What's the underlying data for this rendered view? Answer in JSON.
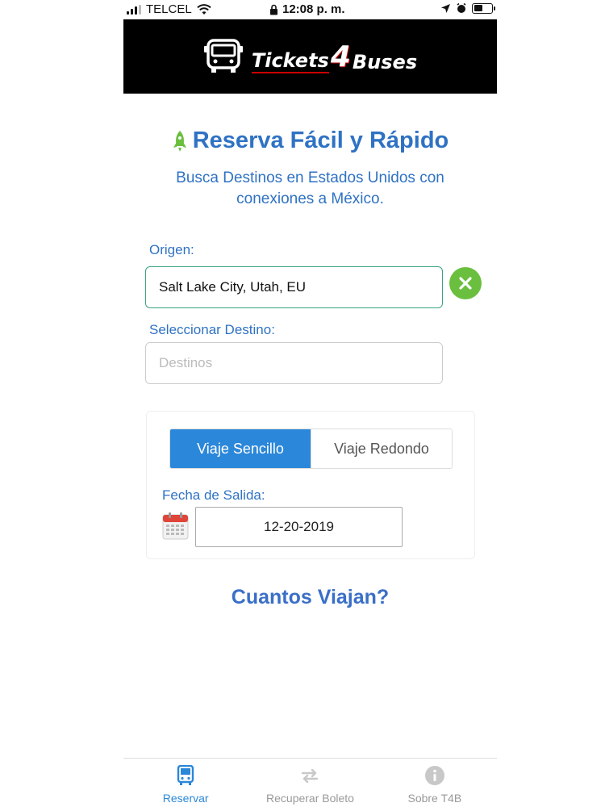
{
  "status_bar": {
    "carrier": "TELCEL",
    "time": "12:08 p. m.",
    "battery_level": 0.5
  },
  "header": {
    "logo": {
      "part1": "Tickets",
      "part2": "4",
      "part3": "Buses"
    }
  },
  "main": {
    "title": "Reserva Fácil y Rápido",
    "subtitle": "Busca Destinos en Estados Unidos con conexiones a México.",
    "origin": {
      "label": "Origen:",
      "value": "Salt Lake City, Utah, EU"
    },
    "destination": {
      "label": "Seleccionar Destino:",
      "placeholder": "Destinos"
    },
    "trip_type": {
      "options": [
        "Viaje Sencillo",
        "Viaje Redondo"
      ],
      "selected": "Viaje Sencillo"
    },
    "departure": {
      "label": "Fecha de Salida:",
      "date": "12-20-2019"
    },
    "passengers_heading": "Cuantos Viajan?"
  },
  "tabbar": {
    "items": [
      {
        "label": "Reservar",
        "icon": "bus-icon",
        "active": true
      },
      {
        "label": "Recuperar Boleto",
        "icon": "exchange-icon",
        "active": false
      },
      {
        "label": "Sobre T4B",
        "icon": "info-icon",
        "active": false
      }
    ]
  },
  "colors": {
    "accent": "#2b87d9",
    "heading": "#2f72c4",
    "success": "#6bbf3f",
    "header_bg": "#000000"
  }
}
